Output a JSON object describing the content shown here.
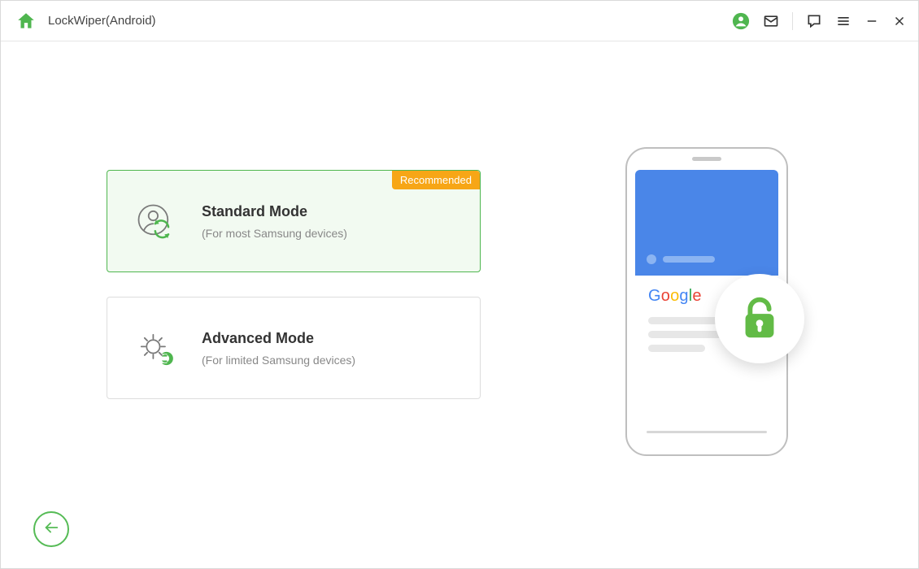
{
  "titlebar": {
    "app_name": "LockWiper(Android)"
  },
  "modes": {
    "standard": {
      "title": "Standard Mode",
      "subtitle": "(For most Samsung devices)",
      "badge": "Recommended"
    },
    "advanced": {
      "title": "Advanced Mode",
      "subtitle": "(For limited Samsung devices)"
    }
  },
  "illustration": {
    "logo_text": "Google"
  },
  "colors": {
    "accent_green": "#4fb64f",
    "badge_orange": "#f7a616",
    "phone_blue": "#4a86e8"
  }
}
